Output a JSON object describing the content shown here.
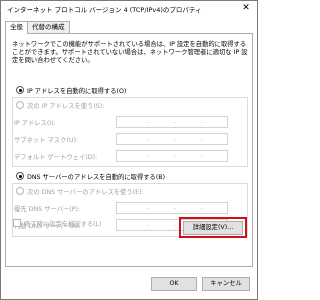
{
  "window": {
    "title": "インターネット プロトコル バージョン 4 (TCP/IPv4)のプロパティ",
    "close_glyph": "✕"
  },
  "tabs": [
    {
      "label": "全般",
      "active": true
    },
    {
      "label": "代替の構成",
      "active": false
    }
  ],
  "description": "ネットワークでこの機能がサポートされている場合は、IP 設定を自動的に取得することができます。サポートされていない場合は、ネットワーク管理者に適切な IP 設定を問い合わせてください。",
  "ip_section": {
    "auto_label": "IP アドレスを自動的に取得する(O)",
    "manual_label": "次の IP アドレスを使う(S):",
    "fields": [
      {
        "label": "IP アドレス(I):",
        "value": ""
      },
      {
        "label": "サブネット マスク(U):",
        "value": ""
      },
      {
        "label": "デフォルト ゲートウェイ(D):",
        "value": ""
      }
    ]
  },
  "dns_section": {
    "auto_label": "DNS サーバーのアドレスを自動的に取得する(B)",
    "manual_label": "次の DNS サーバーのアドレスを使う(E):",
    "fields": [
      {
        "label": "優先 DNS サーバー(P):",
        "value": ""
      },
      {
        "label": "代替 DNS サーバー(A):",
        "value": ""
      }
    ]
  },
  "validate_checkbox_label": "終了時に設定を検証する(L)",
  "buttons": {
    "advanced": "詳細設定(V)...",
    "ok": "OK",
    "cancel": "キャンセル"
  },
  "colors": {
    "highlight": "#d0111b",
    "disabled_text": "#a0a0a0"
  }
}
